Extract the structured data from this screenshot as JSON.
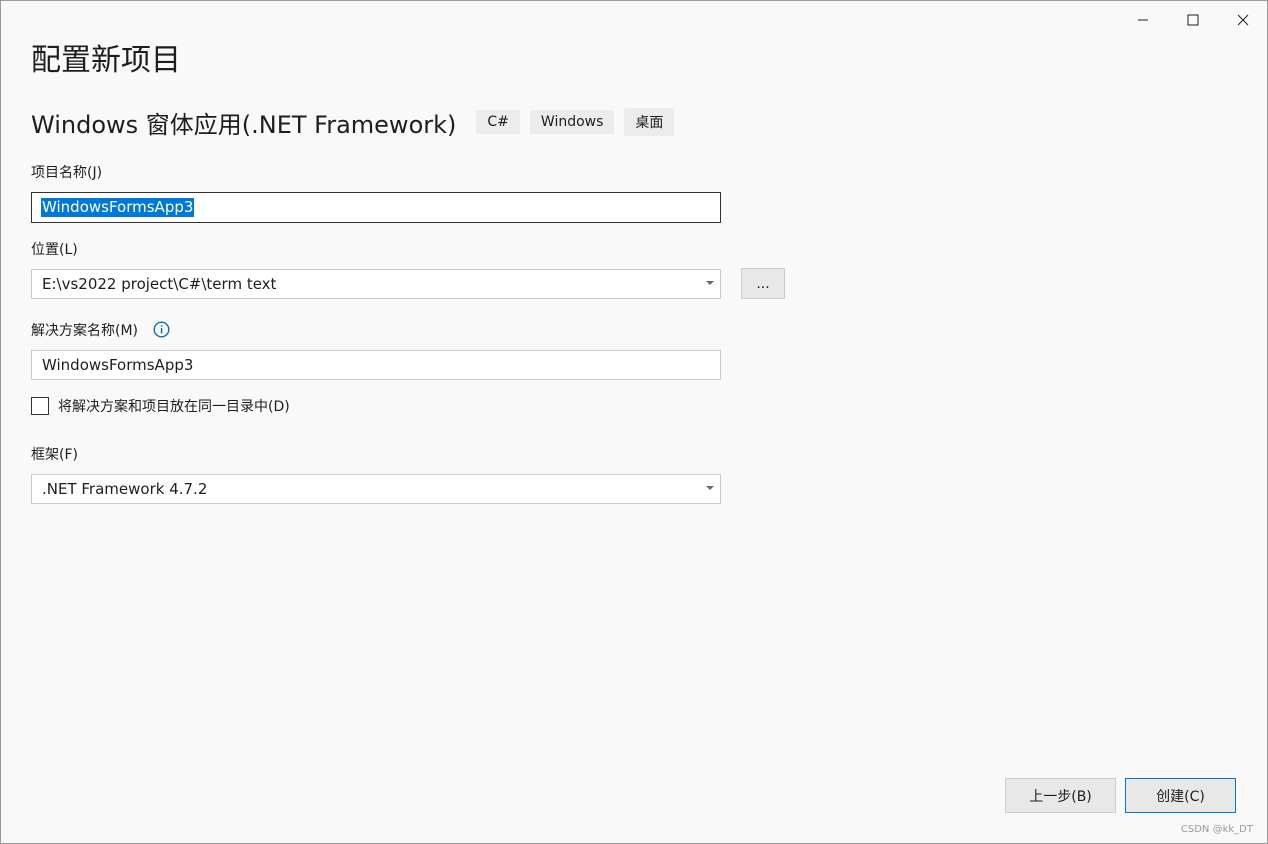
{
  "window": {
    "controls": {
      "minimize_icon": "minimize-icon",
      "maximize_icon": "maximize-icon",
      "close_icon": "close-icon"
    }
  },
  "page_title": "配置新项目",
  "template": {
    "name": "Windows 窗体应用(.NET Framework)",
    "tags": [
      "C#",
      "Windows",
      "桌面"
    ]
  },
  "project_name": {
    "label": "项目名称(J)",
    "value": "WindowsFormsApp3"
  },
  "location": {
    "label": "位置(L)",
    "value": "E:\\vs2022 project\\C#\\term text",
    "browse_label": "..."
  },
  "solution_name": {
    "label": "解决方案名称(M)",
    "value": "WindowsFormsApp3",
    "info_icon": "info-icon"
  },
  "same_directory": {
    "label": "将解决方案和项目放在同一目录中(D)",
    "checked": false
  },
  "framework": {
    "label": "框架(F)",
    "value": ".NET Framework 4.7.2"
  },
  "footer": {
    "back_label": "上一步(B)",
    "create_label": "创建(C)"
  },
  "watermark": "CSDN @kk_DT",
  "colors": {
    "accent": "#0078d7",
    "background": "#f9f9f9",
    "info_icon": "#0a6fb8"
  }
}
